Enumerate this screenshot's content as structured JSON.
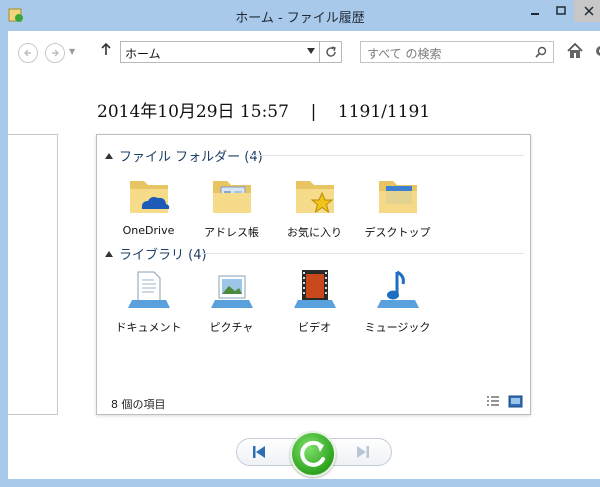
{
  "window": {
    "title": "ホーム - ファイル履歴",
    "icons": {
      "app": "file-history-icon",
      "minimize": "minimize-icon",
      "maximize": "maximize-icon",
      "close": "close-icon"
    }
  },
  "nav": {
    "address_value": "ホーム",
    "search_placeholder": "すべて の検索",
    "icons": [
      "back-arrow-icon",
      "forward-arrow-icon",
      "up-arrow-icon",
      "refresh-icon",
      "search-icon",
      "home-icon",
      "gear-icon"
    ]
  },
  "snapshot": {
    "date_time": "2014年10月29日 15:57",
    "separator": "|",
    "position": "1191/1191"
  },
  "groups": [
    {
      "header": "ファイル フォルダー (4)",
      "items": [
        {
          "label": "OneDrive",
          "icon": "onedrive-folder-icon"
        },
        {
          "label": "アドレス帳",
          "icon": "contacts-folder-icon"
        },
        {
          "label": "お気に入り",
          "icon": "favorites-folder-icon"
        },
        {
          "label": "デスクトップ",
          "icon": "desktop-folder-icon"
        }
      ]
    },
    {
      "header": "ライブラリ (4)",
      "items": [
        {
          "label": "ドキュメント",
          "icon": "documents-library-icon"
        },
        {
          "label": "ピクチャ",
          "icon": "pictures-library-icon"
        },
        {
          "label": "ビデオ",
          "icon": "videos-library-icon"
        },
        {
          "label": "ミュージック",
          "icon": "music-library-icon"
        }
      ]
    }
  ],
  "status": {
    "item_count": "8 個の項目"
  },
  "playback": {
    "icons": [
      "previous-version-icon",
      "restore-icon",
      "next-version-icon"
    ]
  }
}
